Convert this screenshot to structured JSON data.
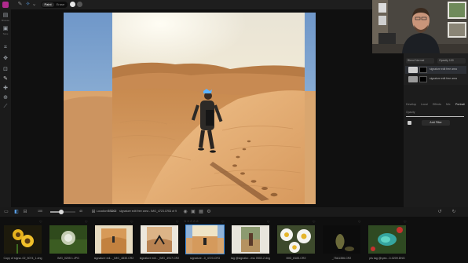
{
  "toolbar": {
    "mode_paint": "Paint",
    "mode_erase": "Erase",
    "icons": [
      "brush-settings-icon",
      "magic-brush-icon",
      "erase-reset-icon",
      "overlay-toggle-icon"
    ]
  },
  "left_rail": {
    "browse_label": "Browse",
    "save_label": "Save",
    "tools": [
      "move-icon",
      "transform-icon",
      "crop-icon",
      "heal-icon",
      "brush-icon",
      "gradient-icon",
      "clone-icon",
      "eyedropper-icon",
      "text-icon"
    ]
  },
  "right_panel": {
    "blend_label": "Blend",
    "blend_value": "Normal",
    "opacity_label": "Opacity",
    "opacity_value": "100",
    "layers": [
      {
        "name": "signature edit free area",
        "active": true
      },
      {
        "name": "signature edit free area",
        "active": false
      }
    ],
    "tabs": [
      "Develop",
      "Local",
      "Effects",
      "Mix",
      "Portrait"
    ],
    "active_tab": "Portrait",
    "opacity_field_label": "Opacity",
    "opacity_fraction": 1.0,
    "add_filter_label": "Add Filter"
  },
  "bottom_bar": {
    "zoom_value": "100",
    "zoom_level_fraction": 0.45,
    "zoom_max": "40",
    "location_label": "Location",
    "location_value": "SSD02",
    "file_path": "signature edit free area - IMG_4723.CR3",
    "page_count": "1 of 9"
  },
  "filmstrip": [
    {
      "name": "Copy of signa..02_5074_1.dng",
      "heart": "♡",
      "stars": ""
    },
    {
      "name": "IMG_0205 1.JPG",
      "heart": "♡",
      "stars": ""
    },
    {
      "name": "signature edi..._IMG_4830.CR2",
      "heart": "♡",
      "stars": ""
    },
    {
      "name": "signature edi..._IMG_4917.CR2",
      "heart": "♡",
      "stars": ""
    },
    {
      "name": "signature...0_4723.CR3",
      "heart": "♡",
      "stars": "☆☆☆☆☆",
      "selected": true
    },
    {
      "name": "tag @signatur...ess 0502-2.dng",
      "heart": "♡",
      "stars": ""
    },
    {
      "name": "IMG_8183.CR2",
      "heart": "♡",
      "stars": ""
    },
    {
      "name": "_75A1356.CR2",
      "heart": "♡",
      "stars": ""
    },
    {
      "name": "pls tag @ryan...0-0209.DNG",
      "heart": "♡",
      "stars": ""
    }
  ],
  "colors": {
    "accent": "#3a8be0",
    "app_logo": "#b02a8e",
    "mask_overlay": "#8a4ad0"
  }
}
